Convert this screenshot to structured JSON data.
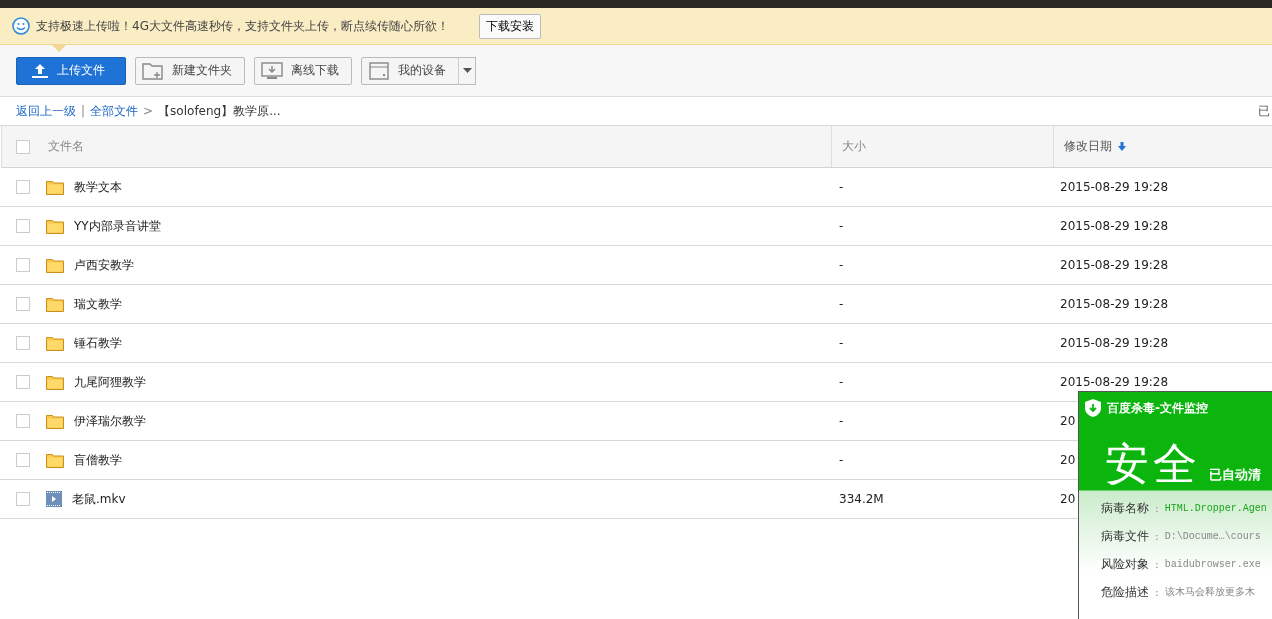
{
  "notice": {
    "text": "支持极速上传啦！4G大文件高速秒传，支持文件夹上传，断点续传随心所欲！",
    "button": "下载安装"
  },
  "toolbar": [
    {
      "kind": "primary",
      "label": "上传文件"
    },
    {
      "kind": "folder",
      "label": "新建文件夹"
    },
    {
      "kind": "download",
      "label": "离线下载"
    },
    {
      "kind": "device",
      "label": "我的设备"
    }
  ],
  "breadcrumb": {
    "back": "返回上一级",
    "divider": "|",
    "root": "全部文件",
    "separator": ">",
    "current": "【solofeng】教学原...",
    "right": "已"
  },
  "table": {
    "select_all_checked": false,
    "columns": [
      {
        "label": "文件名",
        "sorted": false
      },
      {
        "label": "大小",
        "sorted": false
      },
      {
        "label": "修改日期",
        "sorted": true
      }
    ],
    "rows": [
      {
        "kind": "folder",
        "name": "教学文本",
        "size": "-",
        "date": "2015-08-29 19:28",
        "checked": false
      },
      {
        "kind": "folder",
        "name": "YY内部录音讲堂",
        "size": "-",
        "date": "2015-08-29 19:28",
        "checked": false
      },
      {
        "kind": "folder",
        "name": "卢西安教学",
        "size": "-",
        "date": "2015-08-29 19:28",
        "checked": false
      },
      {
        "kind": "folder",
        "name": "瑞文教学",
        "size": "-",
        "date": "2015-08-29 19:28",
        "checked": false
      },
      {
        "kind": "folder",
        "name": "锤石教学",
        "size": "-",
        "date": "2015-08-29 19:28",
        "checked": false
      },
      {
        "kind": "folder",
        "name": "九尾阿狸教学",
        "size": "-",
        "date": "2015-08-29 19:28",
        "checked": false
      },
      {
        "kind": "folder",
        "name": "伊泽瑞尔教学",
        "size": "-",
        "date": "20",
        "checked": false
      },
      {
        "kind": "folder",
        "name": "盲僧教学",
        "size": "-",
        "date": "20",
        "checked": false
      },
      {
        "kind": "video",
        "name": "老鼠.mkv",
        "size": "334.2M",
        "date": "20",
        "checked": false
      }
    ]
  },
  "popup": {
    "title": "百度杀毒-文件监控",
    "status": "安全",
    "status_note": "已自动清",
    "fields": [
      {
        "label": "病毒名称",
        "colon": ":",
        "value": "HTML.Dropper.Agen",
        "highlight": true
      },
      {
        "label": "病毒文件",
        "colon": ":",
        "value": "D:\\Docume…\\cours",
        "highlight": false
      },
      {
        "label": "风险对象",
        "colon": ":",
        "value": "baidubrowser.exe",
        "highlight": false
      },
      {
        "label": "危险描述",
        "colon": ":",
        "value": "该木马会释放更多木",
        "highlight": false
      }
    ]
  }
}
